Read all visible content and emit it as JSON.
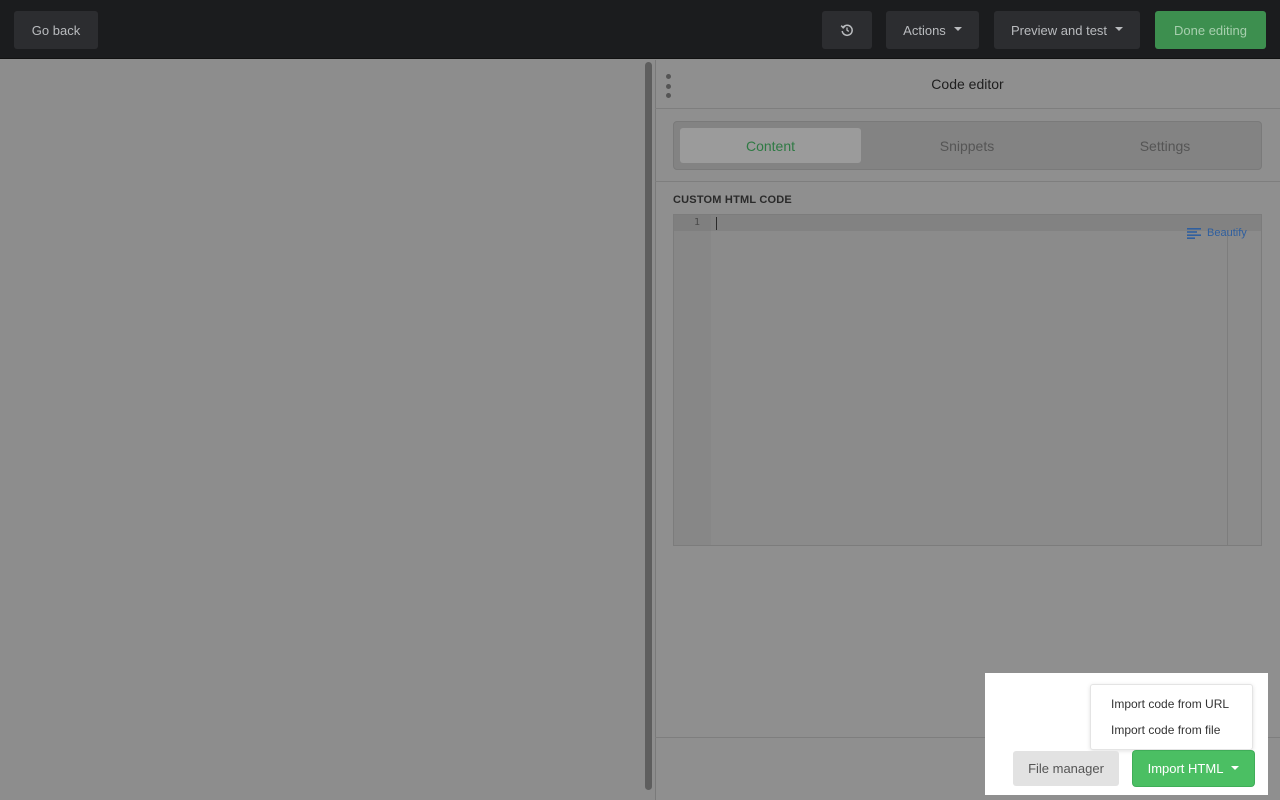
{
  "topbar": {
    "back_label": "Go back",
    "actions_label": "Actions",
    "preview_label": "Preview and test",
    "done_label": "Done editing"
  },
  "panel": {
    "title": "Code editor",
    "tabs": [
      {
        "label": "Content",
        "active": true
      },
      {
        "label": "Snippets",
        "active": false
      },
      {
        "label": "Settings",
        "active": false
      }
    ],
    "section_label": "CUSTOM HTML CODE",
    "editor": {
      "line_numbers": [
        "1"
      ],
      "beautify_label": "Beautify"
    }
  },
  "footer": {
    "file_manager_label": "File manager",
    "import_label": "Import HTML",
    "import_menu": [
      {
        "label": "Import code from URL"
      },
      {
        "label": "Import code from file"
      }
    ]
  },
  "colors": {
    "topbar_bg": "#1b1c1e",
    "done_green": "#3d8f4f",
    "import_green": "#4bbf63",
    "active_tab_text": "#2f7a44",
    "beautify_blue": "#2f5f9f"
  },
  "icons": {
    "history": "history-icon",
    "caret": "caret-down-icon",
    "handle": "drag-handle-icon",
    "beautify": "align-lines-icon"
  }
}
